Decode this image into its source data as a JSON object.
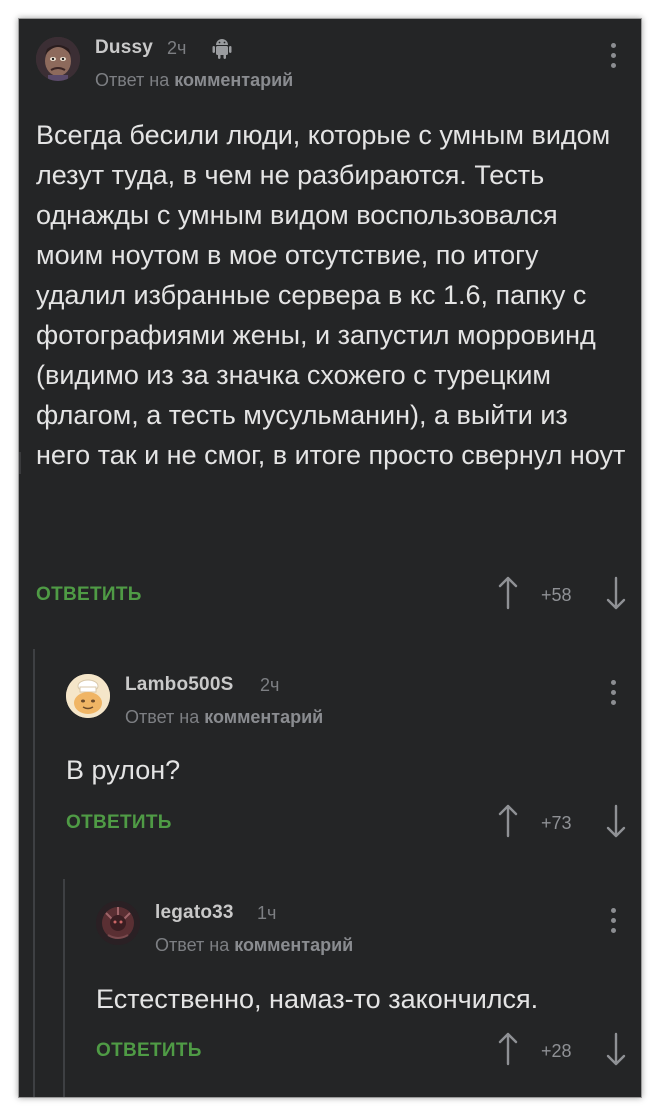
{
  "comments": [
    {
      "nick": "Dussy",
      "time": "2ч",
      "reply_prefix": "Ответ на",
      "reply_link": "комментарий",
      "text": "Всегда бесили люди, которые с умным видом лезут туда, в чем не разбираются. Тесть однажды с умным видом воспользовался моим ноутом в мое отсутствие, по итогу удалил избранные сервера в кс 1.6, папку с фотографиями жены, и запустил морровинд (видимо из за значка схожего с турецким флагом, а тесть мусульманин), а выйти из него так и не смог, в итоге просто свернул ноут",
      "reply_label": "ОТВЕТИТЬ",
      "rating": "+58",
      "device_icon": "android-icon"
    },
    {
      "nick": "Lambo500S",
      "time": "2ч",
      "reply_prefix": "Ответ на",
      "reply_link": "комментарий",
      "text": "В рулон?",
      "reply_label": "ОТВЕТИТЬ",
      "rating": "+73"
    },
    {
      "nick": "legato33",
      "time": "1ч",
      "reply_prefix": "Ответ на",
      "reply_link": "комментарий",
      "text": "Естественно, намаз-то закончился.",
      "reply_label": "ОТВЕТИТЬ",
      "rating": "+28"
    }
  ],
  "colors": {
    "background": "#242526",
    "text": "#e4e4e4",
    "meta": "#7d7f83",
    "reply_button": "#4f9b45",
    "thread_line": "#3e4043"
  }
}
